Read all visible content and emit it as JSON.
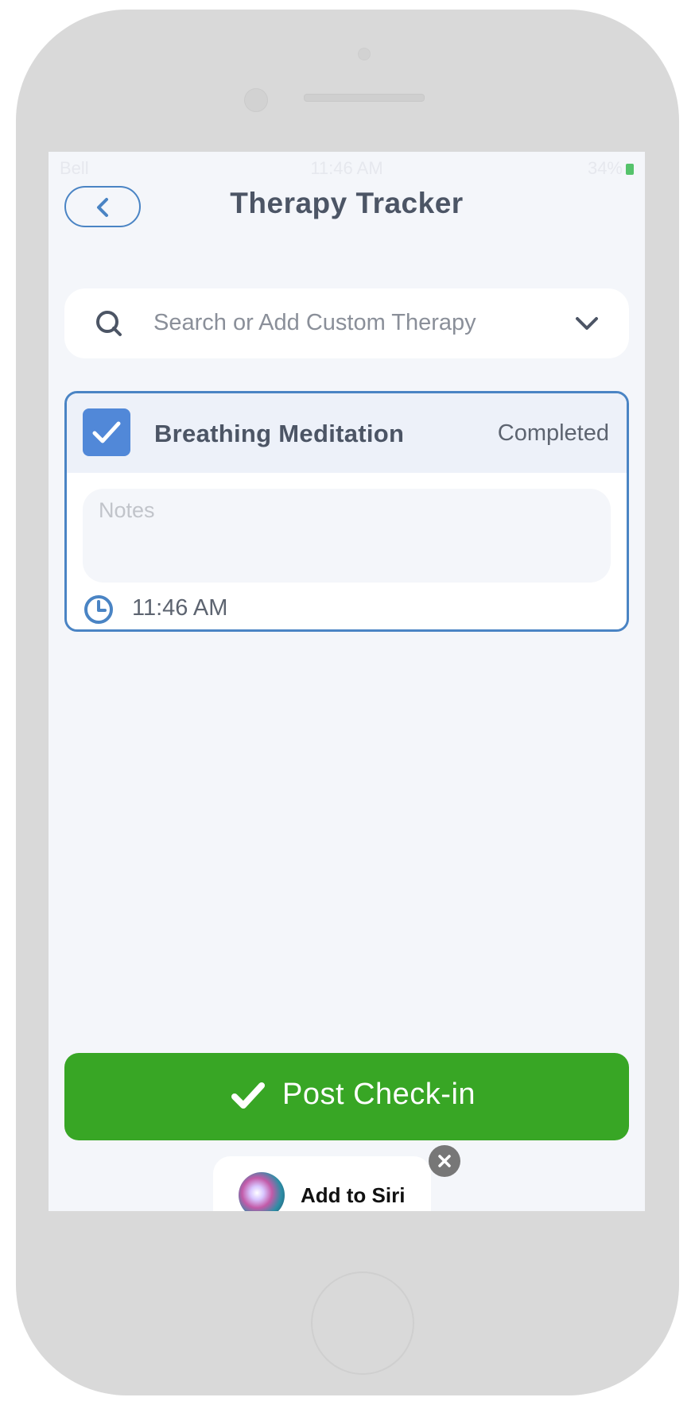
{
  "status_bar": {
    "carrier": "Bell",
    "time": "11:46 AM",
    "battery": "34%"
  },
  "header": {
    "title": "Therapy Tracker",
    "back_icon": "chevron-left-icon"
  },
  "search": {
    "placeholder": "Search or Add Custom Therapy",
    "icon": "search-icon",
    "dropdown_icon": "chevron-down-icon"
  },
  "therapy_card": {
    "name": "Breathing Meditation",
    "status": "Completed",
    "checked": true,
    "notes_placeholder": "Notes",
    "time": "11:46 AM",
    "accent_color": "#4a84c4"
  },
  "actions": {
    "post_label": "Post Check-in",
    "post_color": "#38a625"
  },
  "siri": {
    "label": "Add to Siri",
    "close_icon": "close-icon"
  }
}
